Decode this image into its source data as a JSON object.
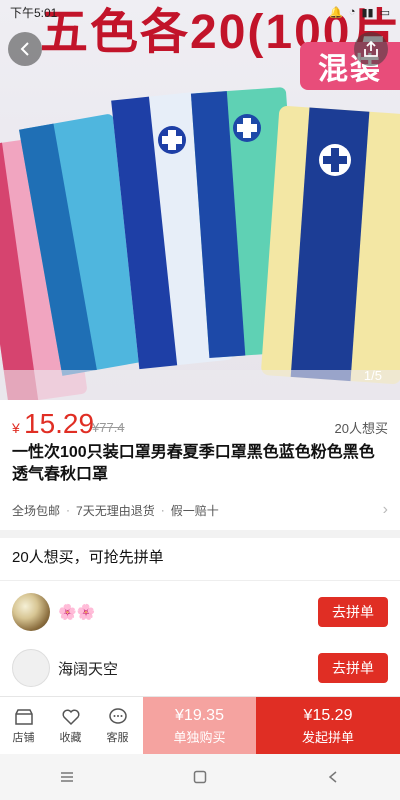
{
  "status_bar": {
    "time": "下午5:01"
  },
  "hero": {
    "banner_text": "五色各20(100片",
    "mixed_tag": "混装",
    "image_counter": "1/5",
    "mask_colors": [
      "#f1a5c0",
      "#4fb6de",
      "#e7eef8",
      "#5fd1b4",
      "#f3e7a4"
    ],
    "mask_band_colors": [
      "#d6446f",
      "#1f6fb5",
      "#1e3fa6",
      "#1d49a8",
      "#1c3d95"
    ]
  },
  "price": {
    "currency": "¥",
    "current": "15.29",
    "original": "¥77.4",
    "wants": "20人想买"
  },
  "product_title": "一性次100只装口罩男春夏季口罩黑色蓝色粉色黑色透气春秋口罩",
  "services": [
    "全场包邮",
    "7天无理由退货",
    "假一赔十"
  ],
  "group_buy": {
    "heading": "20人想买，可抢先拼单",
    "rows": [
      {
        "name": "🌸🌸",
        "button": "去拼单"
      },
      {
        "name": "海阔天空",
        "button": "去拼单"
      }
    ]
  },
  "action_bar": {
    "store": "店铺",
    "favorite": "收藏",
    "service": "客服",
    "solo_price": "¥19.35",
    "solo_label": "单独购买",
    "group_price": "¥15.29",
    "group_label": "发起拼单"
  },
  "colors": {
    "accent": "#e02e24",
    "solo_bg": "#f5a3a0"
  }
}
